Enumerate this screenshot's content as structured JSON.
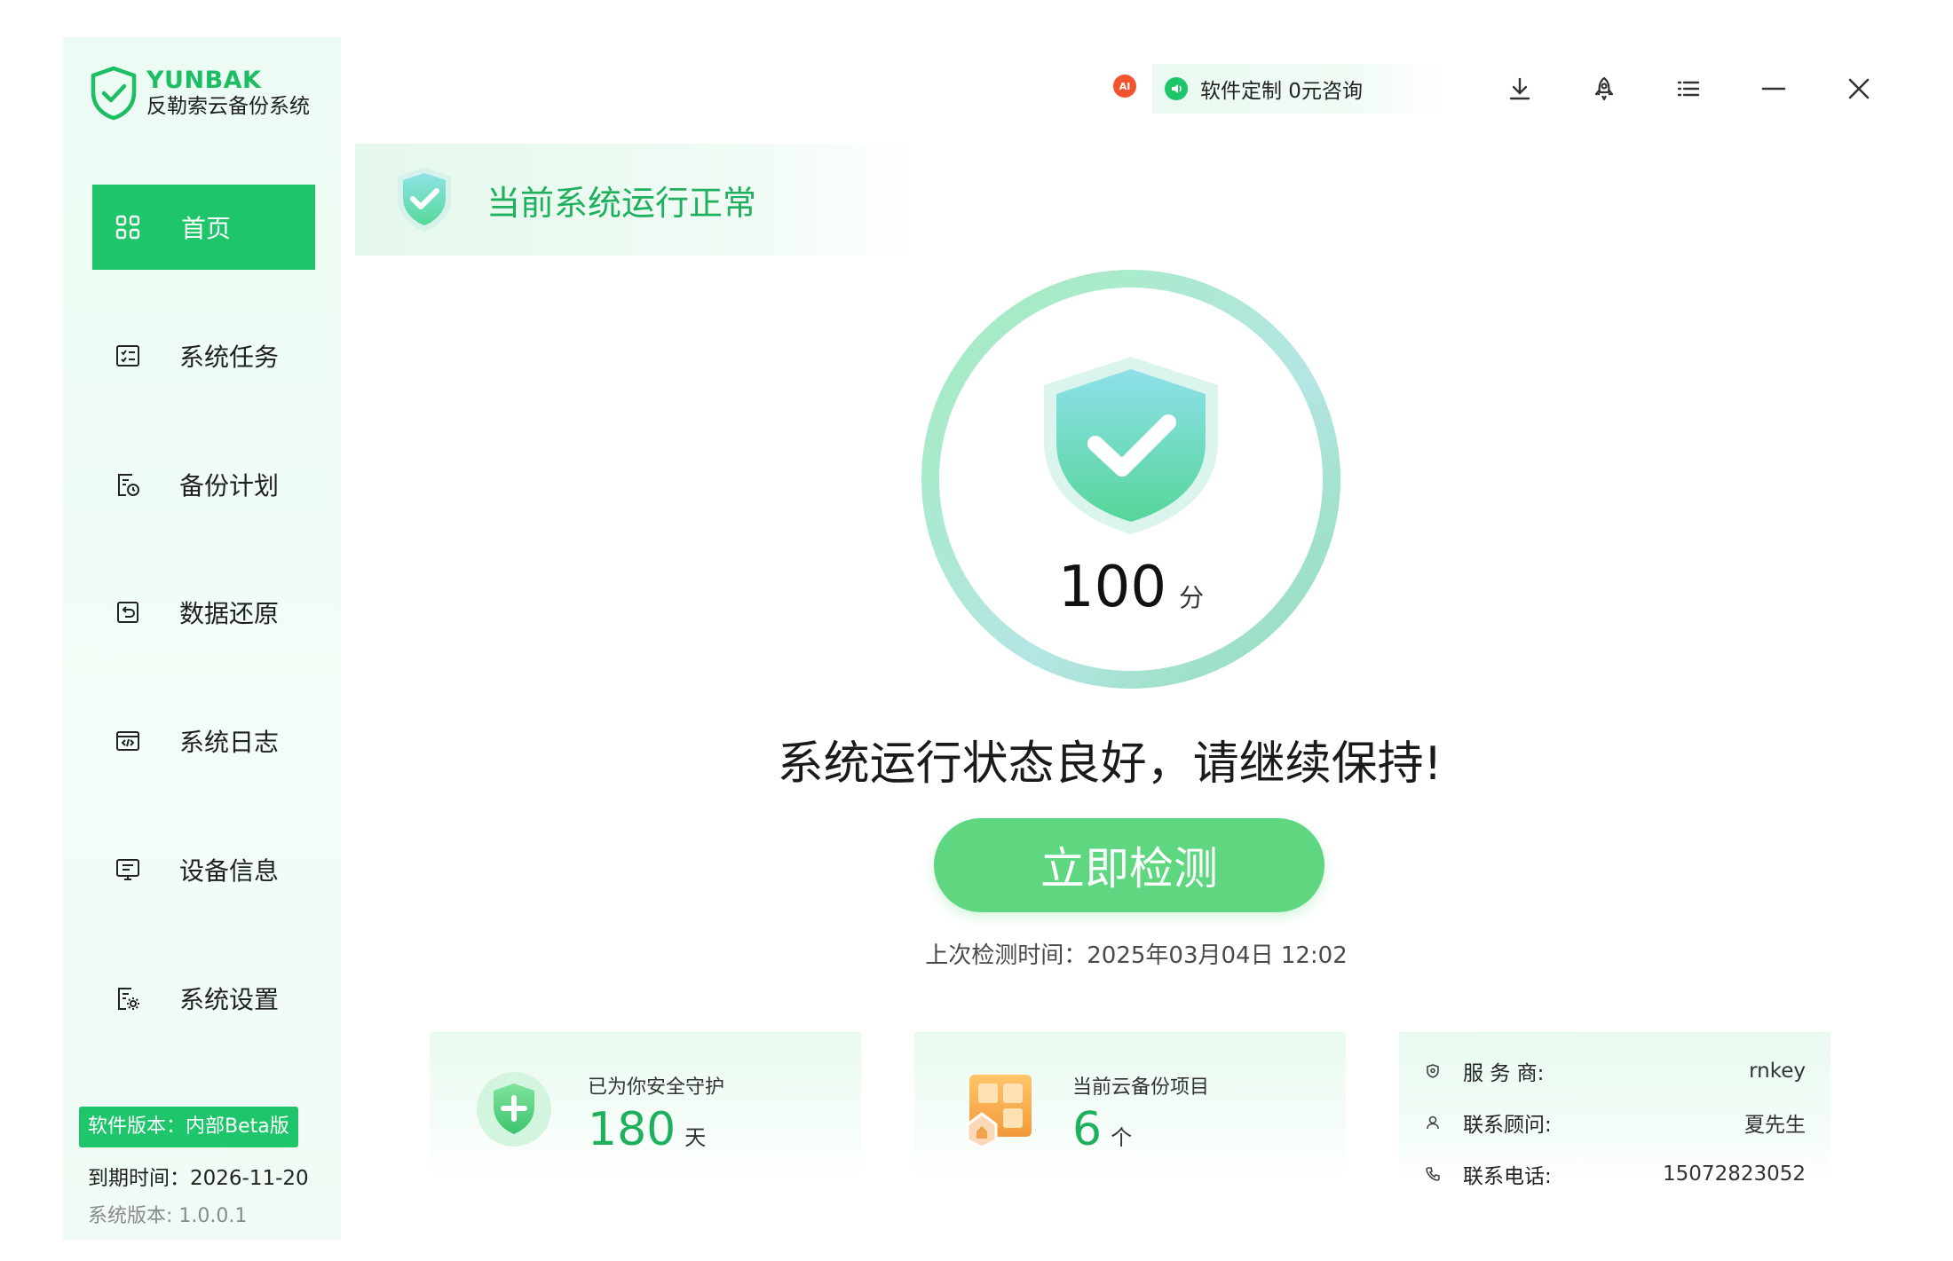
{
  "app": {
    "brand": "YUNBAK",
    "subtitle": "反勒索云备份系统"
  },
  "sidebar": {
    "items": [
      {
        "label": "首页",
        "icon": "grid-icon",
        "active": true
      },
      {
        "label": "系统任务",
        "icon": "task-list-icon"
      },
      {
        "label": "备份计划",
        "icon": "backup-plan-icon"
      },
      {
        "label": "数据还原",
        "icon": "restore-icon"
      },
      {
        "label": "系统日志",
        "icon": "log-icon"
      },
      {
        "label": "设备信息",
        "icon": "monitor-icon"
      },
      {
        "label": "系统设置",
        "icon": "settings-icon"
      }
    ],
    "version_badge": "软件版本：内部Beta版",
    "expiry": "到期时间：2026-11-20",
    "system_version": "系统版本: 1.0.0.1"
  },
  "topbar": {
    "ai_badge": "AI",
    "consult_text": "软件定制 0元咨询",
    "icons": [
      "download-icon",
      "rocket-icon",
      "menu-icon",
      "minimize-icon",
      "close-icon"
    ]
  },
  "status_banner": {
    "text": "当前系统运行正常"
  },
  "score": {
    "value": "100",
    "unit": "分"
  },
  "status_message": "系统运行状态良好，请继续保持!",
  "check_button": "立即检测",
  "last_check": "上次检测时间：2025年03月04日 12:02",
  "cards": {
    "protect": {
      "label": "已为你安全守护",
      "value": "180",
      "unit": "天"
    },
    "backup": {
      "label": "当前云备份项目",
      "value": "6",
      "unit": "个"
    }
  },
  "info": {
    "provider_label": "服 务 商:",
    "provider_value": "rnkey",
    "advisor_label": "联系顾问:",
    "advisor_value": "夏先生",
    "phone_label": "联系电话:",
    "phone_value": "15072823052"
  },
  "colors": {
    "accent": "#1fc56a",
    "button": "#5fd680",
    "ai_badge": "#f1552d"
  }
}
